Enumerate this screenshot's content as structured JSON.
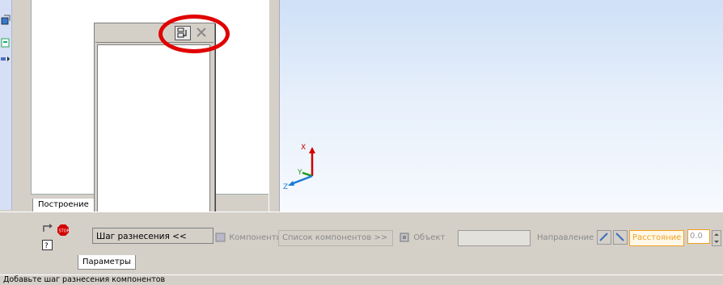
{
  "left_toolbar": {
    "icons": [
      "construction-icon",
      "tree-view-icon",
      "expand-arrow-icon"
    ]
  },
  "tree_panel": {
    "tab_label": "Построение"
  },
  "floating_panel": {
    "buttons": [
      "pin-panel-icon",
      "close-panel-icon"
    ]
  },
  "axes": {
    "x_label": "X",
    "y_label": "Y",
    "z_label": "Z"
  },
  "property_bar": {
    "step_button_label": "Шаг разнесения  <<",
    "components_label": "Компоненты",
    "component_list_button": "Список компонентов  >>",
    "object_label": "Объект",
    "object_value": "",
    "direction_label": "Направление",
    "distance_label": "Расстояние",
    "distance_value": "0.0",
    "params_tab_label": "Параметры",
    "colors": {
      "distance_highlight": "#f0a020",
      "stop": "#d40000"
    }
  },
  "status_bar": {
    "text": "Добавьте шаг разнесения компонентов"
  }
}
